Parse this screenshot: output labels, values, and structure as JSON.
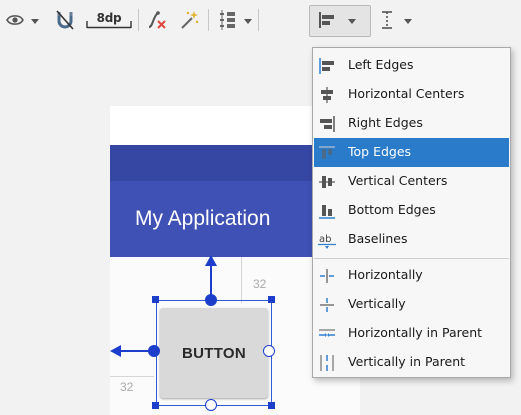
{
  "toolbar": {
    "items": [
      {
        "name": "eye-icon",
        "dropdown": true
      },
      {
        "name": "magnet-off-icon",
        "dropdown": false
      },
      {
        "name": "default-margin",
        "label": "8dp"
      },
      {
        "name": "clear-constraints-icon",
        "dropdown": false
      },
      {
        "name": "infer-constraints-icon",
        "dropdown": false
      },
      {
        "name": "pack-icon",
        "dropdown": true
      },
      {
        "name": "align-icon",
        "dropdown": true,
        "pressed": true
      },
      {
        "name": "guidelines-icon",
        "dropdown": true
      }
    ]
  },
  "menu": {
    "align_items": [
      {
        "label": "Left Edges",
        "icon": "align-left-icon"
      },
      {
        "label": "Horizontal Centers",
        "icon": "align-horizontal-center-icon"
      },
      {
        "label": "Right Edges",
        "icon": "align-right-icon"
      },
      {
        "label": "Top Edges",
        "icon": "align-top-icon",
        "selected": true
      },
      {
        "label": "Vertical Centers",
        "icon": "align-vertical-center-icon"
      },
      {
        "label": "Bottom Edges",
        "icon": "align-bottom-icon"
      },
      {
        "label": "Baselines",
        "icon": "baseline-icon"
      }
    ],
    "center_items": [
      {
        "label": "Horizontally",
        "icon": "center-horizontal-icon"
      },
      {
        "label": "Vertically",
        "icon": "center-vertical-icon"
      },
      {
        "label": "Horizontally in Parent",
        "icon": "center-horizontal-parent-icon"
      },
      {
        "label": "Vertically in Parent",
        "icon": "center-vertical-parent-icon"
      }
    ],
    "colors": {
      "selected": "#2b7bcb",
      "icon": "#4a6a8a",
      "accent": "#2f7fd0"
    }
  },
  "canvas": {
    "app_title": "My Application",
    "button_label": "BUTTON",
    "margin_top": "32",
    "margin_left": "32",
    "colors": {
      "statusbar": "#3646a3",
      "appbar": "#3f51b5",
      "selection": "#1c3ecb"
    }
  }
}
